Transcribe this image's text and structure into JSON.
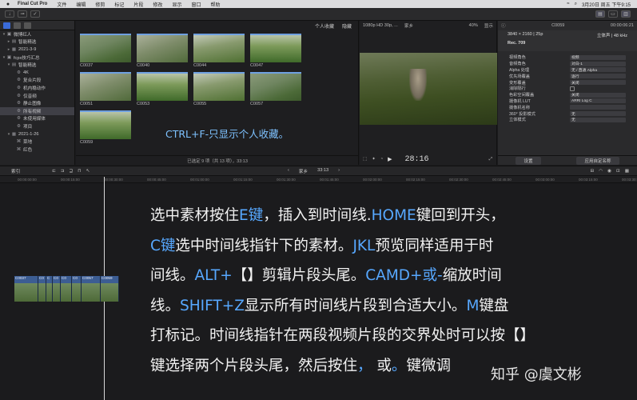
{
  "menubar": {
    "app": "Final Cut Pro",
    "items": [
      "文件",
      "编辑",
      "修剪",
      "标记",
      "片段",
      "修改",
      "显示",
      "窗口",
      "帮助"
    ],
    "datetime": "3月20日 周五 下午9:15"
  },
  "libraries": {
    "rows": [
      {
        "label": "微博红人",
        "tri": "▾",
        "icon": "▣",
        "indent": 0,
        "selected": false
      },
      {
        "label": "智能精选",
        "tri": "▸",
        "icon": "▤",
        "indent": 1,
        "selected": false
      },
      {
        "label": "2021-3-9",
        "tri": "▸",
        "icon": "▦",
        "indent": 1,
        "selected": false
      },
      {
        "label": "fcpx技巧汇总",
        "tri": "▾",
        "icon": "▣",
        "indent": 0,
        "selected": false
      },
      {
        "label": "智能精选",
        "tri": "▾",
        "icon": "▤",
        "indent": 1,
        "selected": false
      },
      {
        "label": "4K",
        "tri": "",
        "icon": "⚙",
        "indent": 2,
        "selected": false
      },
      {
        "label": "复合片段",
        "tri": "",
        "icon": "⚙",
        "indent": 2,
        "selected": false
      },
      {
        "label": "机内稳动作",
        "tri": "",
        "icon": "⚙",
        "indent": 2,
        "selected": false
      },
      {
        "label": "仅音频",
        "tri": "",
        "icon": "⚙",
        "indent": 2,
        "selected": false
      },
      {
        "label": "静止图像",
        "tri": "",
        "icon": "⚙",
        "indent": 2,
        "selected": false
      },
      {
        "label": "所有视频",
        "tri": "",
        "icon": "⚙",
        "indent": 2,
        "selected": true
      },
      {
        "label": "未使用媒体",
        "tri": "",
        "icon": "⚙",
        "indent": 2,
        "selected": false
      },
      {
        "label": "项目",
        "tri": "",
        "icon": "⚙",
        "indent": 2,
        "selected": false
      },
      {
        "label": "2021-1-26",
        "tri": "▾",
        "icon": "▦",
        "indent": 1,
        "selected": false
      },
      {
        "label": "菜地",
        "tri": "",
        "icon": "⌘",
        "indent": 2,
        "selected": false
      },
      {
        "label": "红色",
        "tri": "",
        "icon": "⌘",
        "indent": 2,
        "selected": false
      }
    ]
  },
  "browser": {
    "filter": "个人收藏",
    "view": "隐藏",
    "clips": [
      "C0037",
      "C0040",
      "C0044",
      "C0047",
      "C0051",
      "C0053",
      "C0055",
      "C0057",
      "C0059"
    ],
    "caption": "CTRL+F-只显示个人收藏。",
    "footer": "已选定 9 项（共 13 项），33:13"
  },
  "viewer": {
    "format": "1080p HD 30p, ...",
    "project": "家乡",
    "zoom": "40%",
    "display": "显示",
    "timecode": "28:16"
  },
  "inspector": {
    "clip": "C0059",
    "time": "00:00:06:21",
    "resolution": "3840 × 2160 | 25p",
    "stereo": "立体声 | 48 kHz",
    "codec": "Rec. 709",
    "props": [
      {
        "k": "视频角色",
        "v": "视频"
      },
      {
        "k": "音频角色",
        "v": "对白-1"
      },
      {
        "k": "Alpha 处理",
        "v": "无 / 直通 Alpha"
      },
      {
        "k": "优先场覆盖",
        "v": "逐行"
      },
      {
        "k": "变形覆盖",
        "v": "关闭"
      },
      {
        "k": "消除隔行",
        "v": "",
        "type": "chk"
      },
      {
        "k": "色彩空间覆盖",
        "v": "关闭"
      },
      {
        "k": "摄像机 LUT",
        "v": "ARRI Log C"
      },
      {
        "k": "摄像机名称",
        "v": ""
      },
      {
        "k": "360° 投影模式",
        "v": "无"
      },
      {
        "k": "立体模式",
        "v": "无"
      }
    ],
    "settings_btn": "设置",
    "custom_btn": "应用自定名称"
  },
  "timeline": {
    "index_label": "索引",
    "project": "家乡",
    "duration": "33:13",
    "ruler": [
      "00:00:00:00",
      "00:00:15:00",
      "00:00:30:00",
      "00:00:45:00",
      "00:01:00:00",
      "00:01:15:00",
      "00:01:30:00",
      "00:01:45:00",
      "00:02:00:00",
      "00:02:15:00",
      "00:02:30:00",
      "00:02:45:00",
      "00:03:00:00",
      "00:03:15:00",
      "00:03:30:00"
    ],
    "segments": [
      "C0037",
      "C0",
      "C",
      "C0",
      "C0",
      "C0",
      "C0057",
      "C0059"
    ]
  },
  "subtitles": [
    [
      {
        "t": "选中素材按住"
      },
      {
        "t": "E键",
        "hl": true
      },
      {
        "t": "，插入到时间线."
      },
      {
        "t": "HOME",
        "hl": true
      },
      {
        "t": "键回到开头，"
      }
    ],
    [
      {
        "t": "C键",
        "hl": true
      },
      {
        "t": "选中时间线指针下的素材。"
      },
      {
        "t": "JKL",
        "hl": true
      },
      {
        "t": "预览同样适用于时"
      }
    ],
    [
      {
        "t": "间线。"
      },
      {
        "t": "ALT+",
        "hl": true
      },
      {
        "t": "【】"
      },
      {
        "t": "剪辑片段头尾。"
      },
      {
        "t": "CAMD+或-",
        "hl": true
      },
      {
        "t": "缩放时间"
      }
    ],
    [
      {
        "t": "线。"
      },
      {
        "t": "SHIFT+Z",
        "hl": true
      },
      {
        "t": "显示所有时间线片段到合适大小。"
      },
      {
        "t": "M",
        "hl": true
      },
      {
        "t": "键盘"
      }
    ],
    [
      {
        "t": "打标记。时间线指针在两段视频片段的交界处时可以按【】"
      }
    ],
    [
      {
        "t": "键选择两个片段头尾，然后按住"
      },
      {
        "t": "，",
        "hl": true
      },
      {
        "t": " 或"
      },
      {
        "t": "。",
        "hl": true
      },
      {
        "t": "键微调"
      }
    ]
  ],
  "watermark": "知乎 @虞文彬",
  "colors": {
    "accent": "#57a8ff",
    "caption": "#7ec2ff",
    "clip_blue": "#2c4b7a"
  }
}
